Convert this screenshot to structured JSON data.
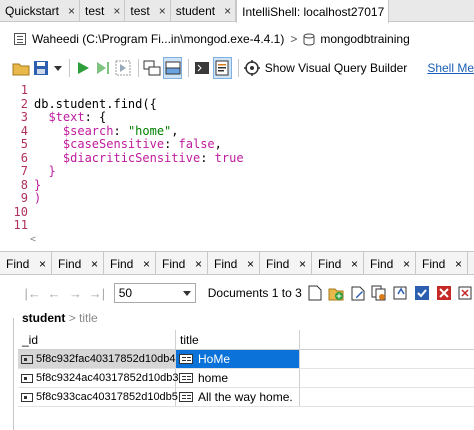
{
  "tabs": [
    {
      "label": "Quickstart",
      "active": false
    },
    {
      "label": "test",
      "active": false
    },
    {
      "label": "test",
      "active": false
    },
    {
      "label": "student",
      "active": false
    },
    {
      "label": "IntelliShell: localhost27017",
      "active": true
    }
  ],
  "connection": {
    "server": "Waheedi (C:\\Program Fi...in\\mongod.exe-4.4.1)",
    "separator": ">",
    "database": "mongodbtraining"
  },
  "toolbar": {
    "visual_query_label": "Show Visual Query Builder",
    "shell_link": "Shell Me"
  },
  "editor": {
    "line_numbers": [
      "1",
      "2",
      "3",
      "4",
      "5",
      "6",
      "7",
      "8",
      "9",
      "10",
      "11"
    ],
    "lines": [
      [],
      [
        {
          "t": "db.student.find({",
          "c": ""
        }
      ],
      [
        {
          "t": "  ",
          "c": ""
        },
        {
          "t": "$text",
          "c": "kw"
        },
        {
          "t": ": {",
          "c": ""
        }
      ],
      [
        {
          "t": "    ",
          "c": ""
        },
        {
          "t": "$search",
          "c": "kw"
        },
        {
          "t": ": ",
          "c": ""
        },
        {
          "t": "\"home\"",
          "c": "str"
        },
        {
          "t": ",",
          "c": ""
        }
      ],
      [
        {
          "t": "    ",
          "c": ""
        },
        {
          "t": "$caseSensitive",
          "c": "kw"
        },
        {
          "t": ": ",
          "c": ""
        },
        {
          "t": "false",
          "c": "kw"
        },
        {
          "t": ",",
          "c": ""
        }
      ],
      [
        {
          "t": "    ",
          "c": ""
        },
        {
          "t": "$diacriticSensitive",
          "c": "kw"
        },
        {
          "t": ": ",
          "c": ""
        },
        {
          "t": "true",
          "c": "kw"
        }
      ],
      [
        {
          "t": "  }",
          "c": "kw"
        }
      ],
      [
        {
          "t": "}",
          "c": "kw"
        }
      ],
      [
        {
          "t": ")",
          "c": "kw"
        }
      ],
      [],
      []
    ]
  },
  "find_tabs": [
    "Find",
    "Find",
    "Find",
    "Find",
    "Find",
    "Find",
    "Find",
    "Find",
    "Find"
  ],
  "results": {
    "page_size": "50",
    "docs_label": "Documents 1 to 3",
    "breadcrumb_collection": "student",
    "breadcrumb_sep": ">",
    "breadcrumb_field": "title",
    "columns": [
      "_id",
      "title"
    ],
    "rows": [
      {
        "id": "5f8c932fac40317852d10db4",
        "title": "HoMe",
        "selected": true
      },
      {
        "id": "5f8c9324ac40317852d10db3",
        "title": "home",
        "selected": false
      },
      {
        "id": "5f8c933cac40317852d10db5",
        "title": "All the way home.",
        "selected": false
      }
    ]
  },
  "colors": {
    "accent": "#0a72d8",
    "keyword": "#c01b9e",
    "string": "#008000",
    "line_number": "#b03060",
    "run_green": "#2e9e3a"
  }
}
